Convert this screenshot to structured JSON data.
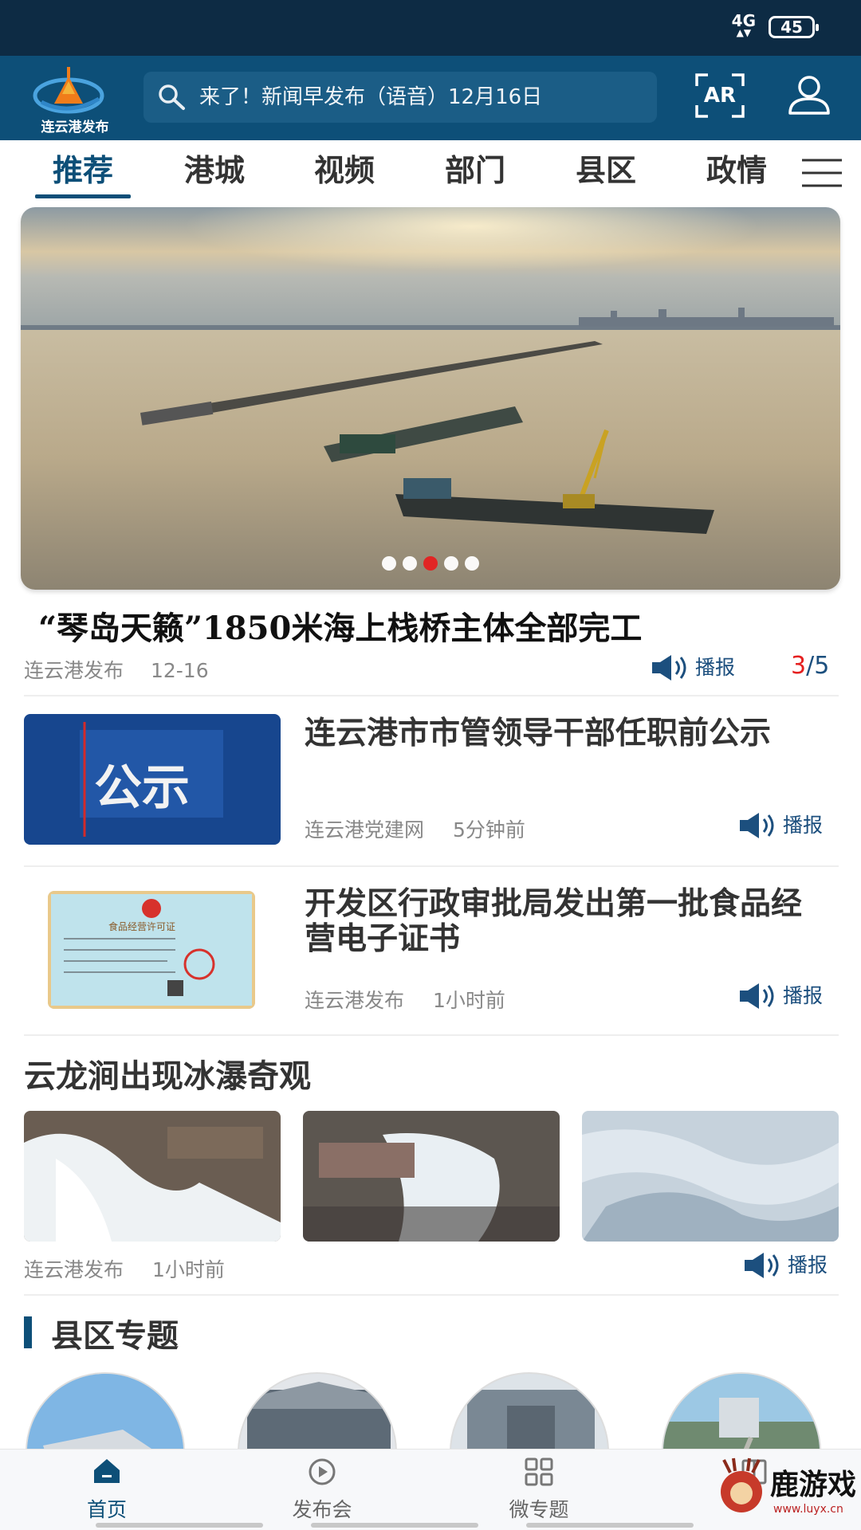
{
  "status_bar": {
    "network": "4G",
    "battery": "45"
  },
  "header": {
    "logo_text": "连云港发布",
    "search_text": "来了！新闻早发布（语音）12月16日",
    "ar_label": "AR"
  },
  "tabs": [
    {
      "label": "推荐"
    },
    {
      "label": "港城"
    },
    {
      "label": "视频"
    },
    {
      "label": "部门"
    },
    {
      "label": "县区"
    },
    {
      "label": "政情"
    }
  ],
  "featured": {
    "headline": "“琴岛天籁”1850米海上栈桥主体全部完工",
    "source": "连云港发布",
    "date": "12-16",
    "play_label": "播报",
    "slide_current": "3",
    "slide_separator": "/",
    "slide_total": "5"
  },
  "news": [
    {
      "title": "连云港市市管领导干部任职前公示",
      "thumb_text": "公示",
      "source": "连云港党建网",
      "time": "5分钟前",
      "play_label": "播报"
    },
    {
      "title": "开发区行政审批局发出第一批食品经营电子证书",
      "thumb_text": "食品经营许可证",
      "source": "连云港发布",
      "time": "1小时前",
      "play_label": "播报"
    }
  ],
  "gallery": {
    "title": "云龙涧出现冰瀑奇观",
    "source": "连云港发布",
    "time": "1小时前",
    "play_label": "播报"
  },
  "county_section": {
    "title": "县区专题"
  },
  "bottom_nav": [
    {
      "label": "首页",
      "icon": "home-icon"
    },
    {
      "label": "发布会",
      "icon": "play-circle-icon"
    },
    {
      "label": "微专题",
      "icon": "grid-icon"
    },
    {
      "label": "",
      "icon": "book-icon"
    }
  ],
  "watermark": {
    "text": "鹿游戏",
    "url": "www.luyx.cn"
  },
  "colors": {
    "brand": "#0d4f78",
    "accent": "#e52020",
    "status_bar": "#0d2b44"
  }
}
